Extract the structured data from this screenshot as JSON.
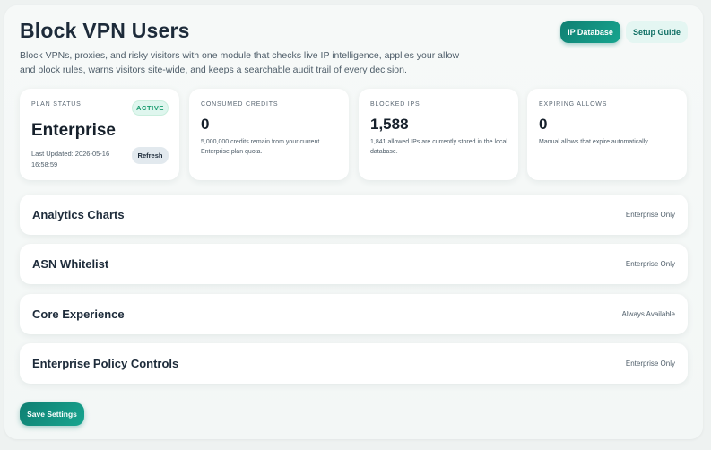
{
  "header": {
    "title": "Block VPN Users",
    "description": "Block VPNs, proxies, and risky visitors with one module that checks live IP intelligence, applies your allow and block rules, warns visitors site-wide, and keeps a searchable audit trail of every decision.",
    "ip_database_label": "IP Database",
    "setup_guide_label": "Setup Guide"
  },
  "stats": {
    "plan": {
      "label": "PLAN STATUS",
      "badge": "ACTIVE",
      "value": "Enterprise",
      "updated": "Last Updated: 2026-05-16 16:58:59",
      "refresh_label": "Refresh"
    },
    "credits": {
      "label": "CONSUMED CREDITS",
      "value": "0",
      "note": "5,000,000 credits remain from your current Enterprise plan quota."
    },
    "blocked": {
      "label": "BLOCKED IPS",
      "value": "1,588",
      "note": "1,841 allowed IPs are currently stored in the local database."
    },
    "expiring": {
      "label": "EXPIRING ALLOWS",
      "value": "0",
      "note": "Manual allows that expire automatically."
    }
  },
  "sections": [
    {
      "title": "Analytics Charts",
      "tag": "Enterprise Only"
    },
    {
      "title": "ASN Whitelist",
      "tag": "Enterprise Only"
    },
    {
      "title": "Core Experience",
      "tag": "Always Available"
    },
    {
      "title": "Enterprise Policy Controls",
      "tag": "Enterprise Only"
    }
  ],
  "footer": {
    "save_label": "Save Settings"
  },
  "colors": {
    "accent": "#0f7f72",
    "accent_light": "#e4f6f2",
    "active_badge": "#179b6d"
  }
}
